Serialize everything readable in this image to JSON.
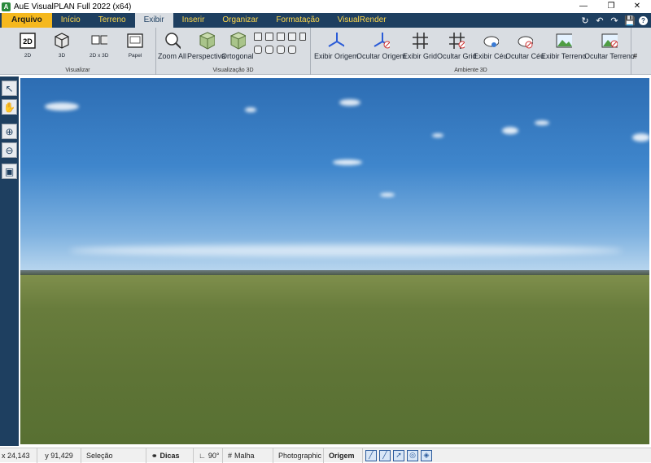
{
  "window": {
    "title": "AuE VisualPLAN Full 2022 (x64)"
  },
  "menu": {
    "file": "Arquivo",
    "tabs": [
      "Início",
      "Terreno",
      "Exibir",
      "Inserir",
      "Organizar",
      "Formatação",
      "VisualRender"
    ],
    "active_tab": "Exibir"
  },
  "ribbon": {
    "visualizar": {
      "label": "Visualizar",
      "buttons": [
        "2D",
        "3D",
        "2D x 3D",
        "Papel"
      ]
    },
    "visualizacao3d": {
      "label": "Visualização 3D",
      "buttons": [
        "Zoom All",
        "Perspectiva",
        "Ortogonal"
      ]
    },
    "ambiente3d": {
      "label": "Ambiente 3D",
      "buttons": [
        "Exibir Origem",
        "Ocultar Origem",
        "Exibir Grid",
        "Ocultar Grid",
        "Exibir Céu",
        "Ocultar Céu",
        "Exibir Terreno",
        "Ocultar Terreno"
      ]
    },
    "overflow": "#"
  },
  "status": {
    "x": "x 24,143",
    "y": "y 91,429",
    "mode": "Seleção",
    "tips": "Dicas",
    "angle": "90°",
    "grid": "Malha",
    "render": "Photographic",
    "origin": "Origem"
  },
  "colors": {
    "menubar": "#1e3f60",
    "file_tab": "#f5b81e",
    "tab_text": "#ffd84a",
    "ribbon": "#d9dde2"
  }
}
